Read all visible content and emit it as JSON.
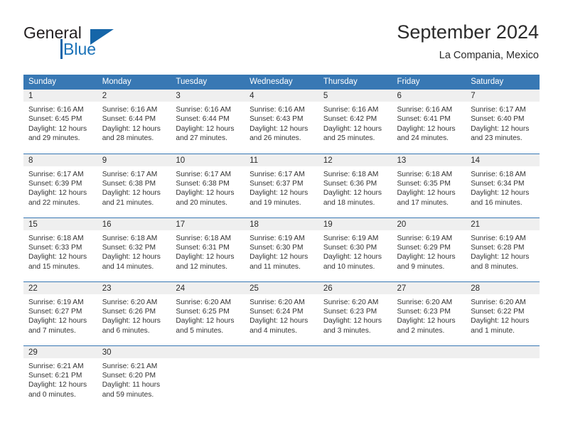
{
  "brand": {
    "name_part1": "General",
    "name_part2": "Blue",
    "logo_icon": "triangle-flag-icon"
  },
  "header": {
    "month_title": "September 2024",
    "location": "La Compania, Mexico"
  },
  "colors": {
    "header_blue": "#3878b4",
    "brand_blue": "#1a72b8",
    "daynum_band": "#efefef",
    "text": "#333333"
  },
  "calendar": {
    "weekday_headers": [
      "Sunday",
      "Monday",
      "Tuesday",
      "Wednesday",
      "Thursday",
      "Friday",
      "Saturday"
    ],
    "weeks": [
      [
        {
          "day": "1",
          "sunrise": "Sunrise: 6:16 AM",
          "sunset": "Sunset: 6:45 PM",
          "daylight": "Daylight: 12 hours and 29 minutes."
        },
        {
          "day": "2",
          "sunrise": "Sunrise: 6:16 AM",
          "sunset": "Sunset: 6:44 PM",
          "daylight": "Daylight: 12 hours and 28 minutes."
        },
        {
          "day": "3",
          "sunrise": "Sunrise: 6:16 AM",
          "sunset": "Sunset: 6:44 PM",
          "daylight": "Daylight: 12 hours and 27 minutes."
        },
        {
          "day": "4",
          "sunrise": "Sunrise: 6:16 AM",
          "sunset": "Sunset: 6:43 PM",
          "daylight": "Daylight: 12 hours and 26 minutes."
        },
        {
          "day": "5",
          "sunrise": "Sunrise: 6:16 AM",
          "sunset": "Sunset: 6:42 PM",
          "daylight": "Daylight: 12 hours and 25 minutes."
        },
        {
          "day": "6",
          "sunrise": "Sunrise: 6:16 AM",
          "sunset": "Sunset: 6:41 PM",
          "daylight": "Daylight: 12 hours and 24 minutes."
        },
        {
          "day": "7",
          "sunrise": "Sunrise: 6:17 AM",
          "sunset": "Sunset: 6:40 PM",
          "daylight": "Daylight: 12 hours and 23 minutes."
        }
      ],
      [
        {
          "day": "8",
          "sunrise": "Sunrise: 6:17 AM",
          "sunset": "Sunset: 6:39 PM",
          "daylight": "Daylight: 12 hours and 22 minutes."
        },
        {
          "day": "9",
          "sunrise": "Sunrise: 6:17 AM",
          "sunset": "Sunset: 6:38 PM",
          "daylight": "Daylight: 12 hours and 21 minutes."
        },
        {
          "day": "10",
          "sunrise": "Sunrise: 6:17 AM",
          "sunset": "Sunset: 6:38 PM",
          "daylight": "Daylight: 12 hours and 20 minutes."
        },
        {
          "day": "11",
          "sunrise": "Sunrise: 6:17 AM",
          "sunset": "Sunset: 6:37 PM",
          "daylight": "Daylight: 12 hours and 19 minutes."
        },
        {
          "day": "12",
          "sunrise": "Sunrise: 6:18 AM",
          "sunset": "Sunset: 6:36 PM",
          "daylight": "Daylight: 12 hours and 18 minutes."
        },
        {
          "day": "13",
          "sunrise": "Sunrise: 6:18 AM",
          "sunset": "Sunset: 6:35 PM",
          "daylight": "Daylight: 12 hours and 17 minutes."
        },
        {
          "day": "14",
          "sunrise": "Sunrise: 6:18 AM",
          "sunset": "Sunset: 6:34 PM",
          "daylight": "Daylight: 12 hours and 16 minutes."
        }
      ],
      [
        {
          "day": "15",
          "sunrise": "Sunrise: 6:18 AM",
          "sunset": "Sunset: 6:33 PM",
          "daylight": "Daylight: 12 hours and 15 minutes."
        },
        {
          "day": "16",
          "sunrise": "Sunrise: 6:18 AM",
          "sunset": "Sunset: 6:32 PM",
          "daylight": "Daylight: 12 hours and 14 minutes."
        },
        {
          "day": "17",
          "sunrise": "Sunrise: 6:18 AM",
          "sunset": "Sunset: 6:31 PM",
          "daylight": "Daylight: 12 hours and 12 minutes."
        },
        {
          "day": "18",
          "sunrise": "Sunrise: 6:19 AM",
          "sunset": "Sunset: 6:30 PM",
          "daylight": "Daylight: 12 hours and 11 minutes."
        },
        {
          "day": "19",
          "sunrise": "Sunrise: 6:19 AM",
          "sunset": "Sunset: 6:30 PM",
          "daylight": "Daylight: 12 hours and 10 minutes."
        },
        {
          "day": "20",
          "sunrise": "Sunrise: 6:19 AM",
          "sunset": "Sunset: 6:29 PM",
          "daylight": "Daylight: 12 hours and 9 minutes."
        },
        {
          "day": "21",
          "sunrise": "Sunrise: 6:19 AM",
          "sunset": "Sunset: 6:28 PM",
          "daylight": "Daylight: 12 hours and 8 minutes."
        }
      ],
      [
        {
          "day": "22",
          "sunrise": "Sunrise: 6:19 AM",
          "sunset": "Sunset: 6:27 PM",
          "daylight": "Daylight: 12 hours and 7 minutes."
        },
        {
          "day": "23",
          "sunrise": "Sunrise: 6:20 AM",
          "sunset": "Sunset: 6:26 PM",
          "daylight": "Daylight: 12 hours and 6 minutes."
        },
        {
          "day": "24",
          "sunrise": "Sunrise: 6:20 AM",
          "sunset": "Sunset: 6:25 PM",
          "daylight": "Daylight: 12 hours and 5 minutes."
        },
        {
          "day": "25",
          "sunrise": "Sunrise: 6:20 AM",
          "sunset": "Sunset: 6:24 PM",
          "daylight": "Daylight: 12 hours and 4 minutes."
        },
        {
          "day": "26",
          "sunrise": "Sunrise: 6:20 AM",
          "sunset": "Sunset: 6:23 PM",
          "daylight": "Daylight: 12 hours and 3 minutes."
        },
        {
          "day": "27",
          "sunrise": "Sunrise: 6:20 AM",
          "sunset": "Sunset: 6:23 PM",
          "daylight": "Daylight: 12 hours and 2 minutes."
        },
        {
          "day": "28",
          "sunrise": "Sunrise: 6:20 AM",
          "sunset": "Sunset: 6:22 PM",
          "daylight": "Daylight: 12 hours and 1 minute."
        }
      ],
      [
        {
          "day": "29",
          "sunrise": "Sunrise: 6:21 AM",
          "sunset": "Sunset: 6:21 PM",
          "daylight": "Daylight: 12 hours and 0 minutes."
        },
        {
          "day": "30",
          "sunrise": "Sunrise: 6:21 AM",
          "sunset": "Sunset: 6:20 PM",
          "daylight": "Daylight: 11 hours and 59 minutes."
        },
        {
          "day": "",
          "sunrise": "",
          "sunset": "",
          "daylight": ""
        },
        {
          "day": "",
          "sunrise": "",
          "sunset": "",
          "daylight": ""
        },
        {
          "day": "",
          "sunrise": "",
          "sunset": "",
          "daylight": ""
        },
        {
          "day": "",
          "sunrise": "",
          "sunset": "",
          "daylight": ""
        },
        {
          "day": "",
          "sunrise": "",
          "sunset": "",
          "daylight": ""
        }
      ]
    ]
  }
}
